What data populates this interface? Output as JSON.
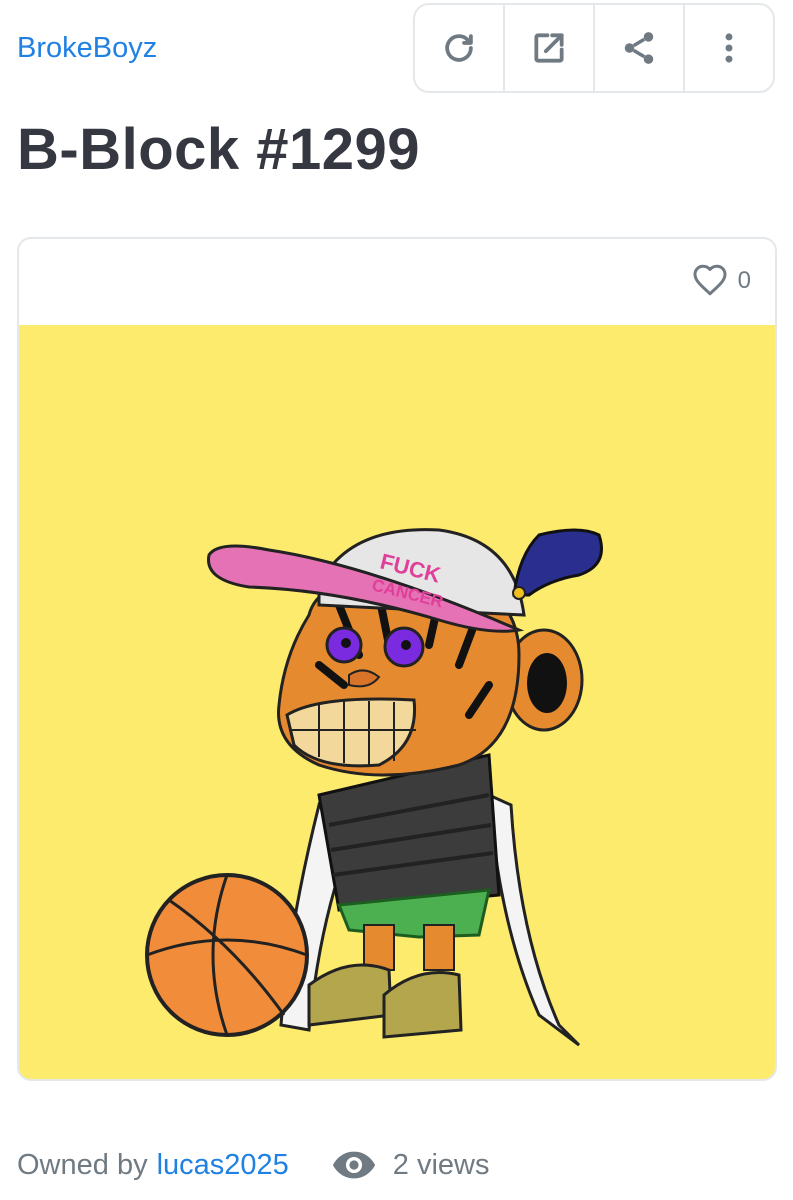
{
  "collection": {
    "name": "BrokeBoyz"
  },
  "toolbar": {
    "buttons": [
      {
        "icon": "refresh-icon"
      },
      {
        "icon": "external-link-icon"
      },
      {
        "icon": "share-icon"
      },
      {
        "icon": "more-vertical-icon"
      }
    ]
  },
  "item": {
    "title": "B-Block #1299",
    "favorites_count": "0",
    "image": {
      "background_color": "#fdeb6e",
      "cap_text_line1": "FUCK",
      "cap_text_line2": "CANCER"
    }
  },
  "footer": {
    "owned_by_label": "Owned by",
    "owner": "lucas2025",
    "views_text": "2 views"
  },
  "colors": {
    "link": "#2081e2",
    "text": "#353840",
    "muted": "#707a83",
    "border": "#e5e8eb"
  }
}
